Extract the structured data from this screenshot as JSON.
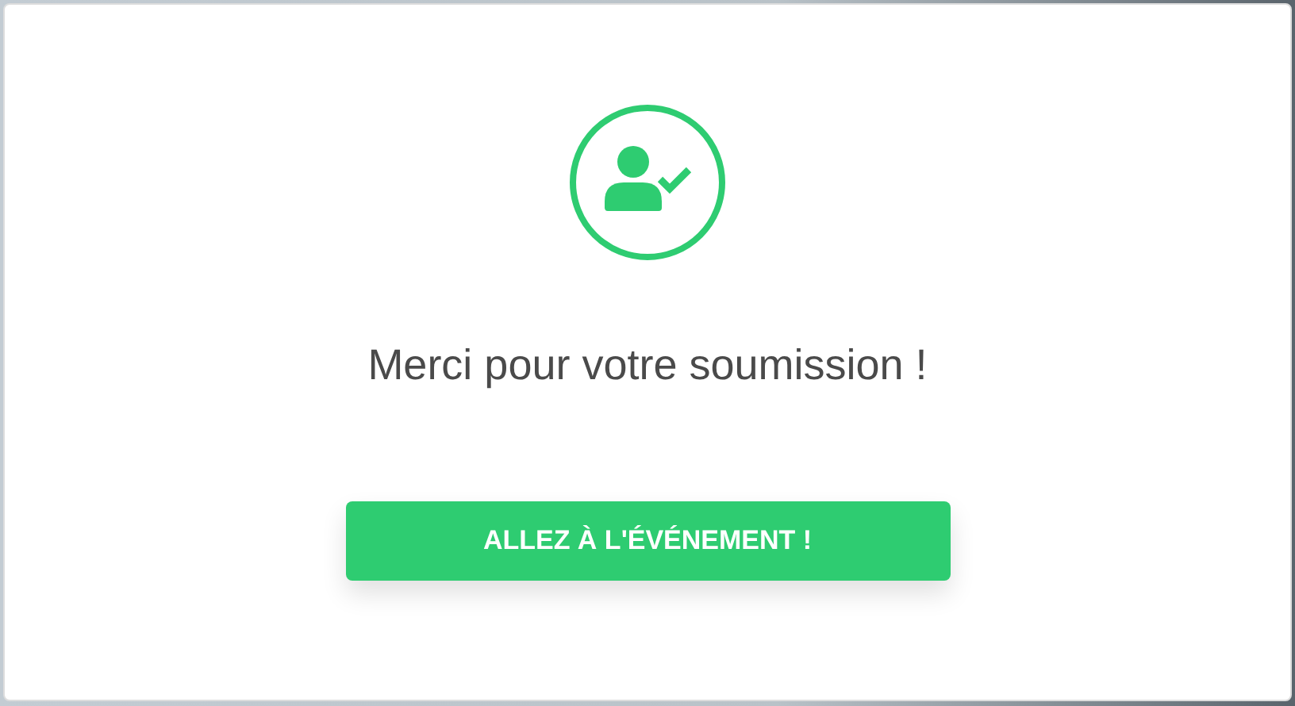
{
  "message": "Merci pour votre soumission !",
  "button": {
    "label": "ALLEZ À L'ÉVÉNEMENT !"
  }
}
